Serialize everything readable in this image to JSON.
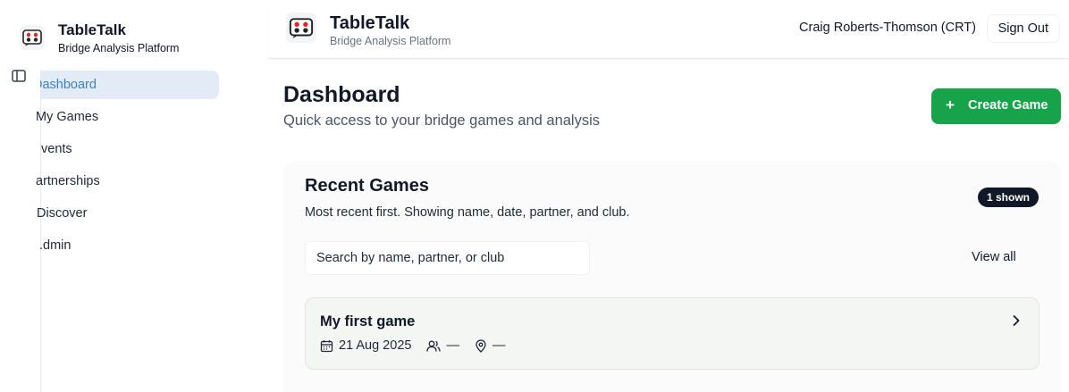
{
  "app": {
    "name": "TableTalk",
    "tagline": "Bridge Analysis Platform"
  },
  "sidebar": {
    "items": [
      {
        "label": "Dashboard",
        "visible": "ashboard",
        "active": true
      },
      {
        "label": "My Games",
        "visible": "My Games",
        "active": false
      },
      {
        "label": "Events",
        "visible": "vents",
        "active": false
      },
      {
        "label": "Partnerships",
        "visible": "artnerships",
        "active": false
      },
      {
        "label": "Discover",
        "visible": "Discover",
        "active": false
      },
      {
        "label": "Admin",
        "visible": ".dmin",
        "active": false
      }
    ]
  },
  "header": {
    "user": "Craig Roberts-Thomson (CRT)",
    "sign_out": "Sign Out"
  },
  "page": {
    "title": "Dashboard",
    "subtitle": "Quick access to your bridge games and analysis",
    "create_label": "Create Game",
    "create_icon": "+"
  },
  "recent": {
    "title": "Recent Games",
    "description": "Most recent first. Showing name, date, partner, and club.",
    "badge": "1 shown",
    "search_placeholder": "Search by name, partner, or club",
    "view_all": "View all",
    "games": [
      {
        "name": "My first game",
        "date": "21 Aug 2025",
        "partner": "—",
        "club": "—"
      }
    ]
  },
  "colors": {
    "accent": "#16a34a",
    "active_nav_bg": "#e3ebf7",
    "active_nav_text": "#3b82c4",
    "badge_bg": "#111827"
  },
  "icons": {
    "logo": "playing-cards-logo",
    "sidebar_toggle": "panel-left-icon",
    "date": "calendar-icon",
    "partner": "users-icon",
    "club": "map-pin-icon",
    "open": "chevron-right-icon"
  }
}
